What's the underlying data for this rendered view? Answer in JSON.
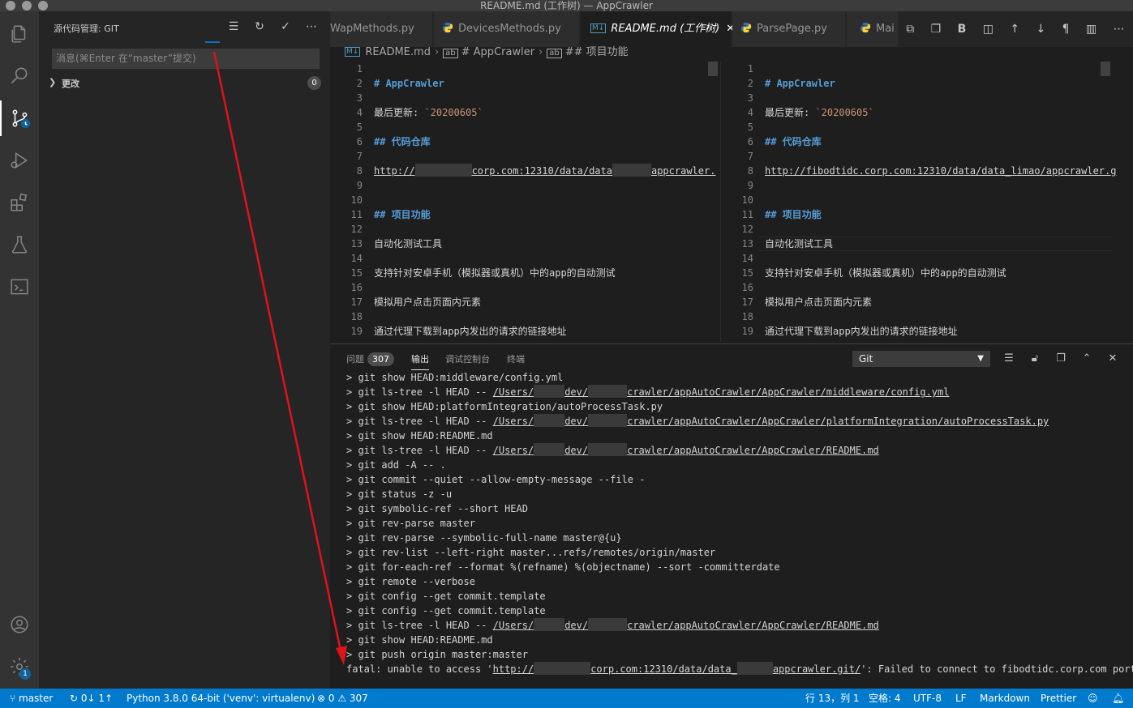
{
  "window": {
    "title": "README.md (工作树) — AppCrawler"
  },
  "activity_bar": {
    "items": [
      {
        "name": "explorer-icon"
      },
      {
        "name": "search-icon"
      },
      {
        "name": "source-control-icon"
      },
      {
        "name": "run-debug-icon"
      },
      {
        "name": "extensions-icon"
      },
      {
        "name": "testing-icon"
      },
      {
        "name": "remote-explorer-icon"
      }
    ],
    "accounts_icon": "account-icon",
    "manage_icon": "gear-icon",
    "manage_badge": "1"
  },
  "scm": {
    "title": "源代码管理: GIT",
    "commit_placeholder": "消息(⌘Enter 在“master”提交)",
    "changes_label": "更改",
    "changes_count": "0"
  },
  "tabs": [
    {
      "label": "WapMethods.py",
      "type": "py"
    },
    {
      "label": "DevicesMethods.py",
      "type": "py"
    },
    {
      "label": "README.md (工作树)",
      "type": "md",
      "active": true
    },
    {
      "label": "ParsePage.py",
      "type": "py"
    },
    {
      "label": "Mai",
      "type": "py"
    }
  ],
  "breadcrumb": {
    "file": "README.md",
    "h1": "# AppCrawler",
    "h2": "## 项目功能"
  },
  "editor_left": {
    "lines": [
      {
        "n": "1",
        "text": ""
      },
      {
        "n": "2",
        "text": "# AppCrawler",
        "kind": "heading"
      },
      {
        "n": "3",
        "text": ""
      },
      {
        "n": "4",
        "prefix": "最后更新: ",
        "code": "`20200605`",
        "kind": "code"
      },
      {
        "n": "5",
        "text": ""
      },
      {
        "n": "6",
        "text": "## 代码仓库",
        "kind": "heading"
      },
      {
        "n": "7",
        "text": ""
      },
      {
        "n": "8",
        "url_a": "http://",
        "url_b": "corp.com:12310/data/data",
        "url_c": "appcrawler.",
        "kind": "redacted-url"
      },
      {
        "n": "9",
        "text": ""
      },
      {
        "n": "10",
        "text": ""
      },
      {
        "n": "11",
        "text": "## 项目功能",
        "kind": "heading"
      },
      {
        "n": "12",
        "text": ""
      },
      {
        "n": "13",
        "text": "自动化测试工具"
      },
      {
        "n": "14",
        "text": ""
      },
      {
        "n": "15",
        "text": "支持针对安卓手机（模拟器或真机）中的app的自动测试"
      },
      {
        "n": "16",
        "text": ""
      },
      {
        "n": "17",
        "text": "模拟用户点击页面内元素"
      },
      {
        "n": "18",
        "text": ""
      },
      {
        "n": "19",
        "text": "通过代理下载到app内发出的请求的链接地址"
      }
    ]
  },
  "editor_right": {
    "lines": [
      {
        "n": "1",
        "text": ""
      },
      {
        "n": "2",
        "text": "# AppCrawler",
        "kind": "heading"
      },
      {
        "n": "3",
        "text": ""
      },
      {
        "n": "4",
        "prefix": "最后更新: ",
        "code": "`20200605`",
        "kind": "code"
      },
      {
        "n": "5",
        "text": ""
      },
      {
        "n": "6",
        "text": "## 代码仓库",
        "kind": "heading"
      },
      {
        "n": "7",
        "text": ""
      },
      {
        "n": "8",
        "text": "http://fibodtidc.corp.com:12310/data/data_limao/appcrawler.g",
        "kind": "link"
      },
      {
        "n": "9",
        "text": ""
      },
      {
        "n": "10",
        "text": ""
      },
      {
        "n": "11",
        "text": "## 项目功能",
        "kind": "heading"
      },
      {
        "n": "12",
        "text": ""
      },
      {
        "n": "13",
        "text": "自动化测试工具"
      },
      {
        "n": "14",
        "text": ""
      },
      {
        "n": "15",
        "text": "支持针对安卓手机（模拟器或真机）中的app的自动测试"
      },
      {
        "n": "16",
        "text": ""
      },
      {
        "n": "17",
        "text": "模拟用户点击页面内元素"
      },
      {
        "n": "18",
        "text": ""
      },
      {
        "n": "19",
        "text": "通过代理下载到app内发出的请求的链接地址"
      }
    ]
  },
  "panel": {
    "tabs": [
      {
        "label": "问题",
        "count": "307"
      },
      {
        "label": "输出",
        "active": true
      },
      {
        "label": "调试控制台"
      },
      {
        "label": "终端"
      }
    ],
    "channel": "Git",
    "output": [
      {
        "text": "> git show HEAD:middleware/config.yml"
      },
      {
        "pre": "> git ls-tree -l HEAD -- ",
        "p1": "/Users/",
        "p2": "dev/",
        "p3": "crawler/appAutoCrawler/AppCrawler/middleware/config.yml",
        "kind": "path"
      },
      {
        "text": "> git show HEAD:platformIntegration/autoProcessTask.py"
      },
      {
        "pre": "> git ls-tree -l HEAD -- ",
        "p1": "/Users/",
        "p2": "dev/",
        "p3": "crawler/appAutoCrawler/AppCrawler/platformIntegration/autoProcessTask.py",
        "kind": "path"
      },
      {
        "text": "> git show HEAD:README.md"
      },
      {
        "pre": "> git ls-tree -l HEAD -- ",
        "p1": "/Users/",
        "p2": "dev/",
        "p3": "crawler/appAutoCrawler/AppCrawler/README.md",
        "kind": "path"
      },
      {
        "text": "> git add -A -- ."
      },
      {
        "text": "> git commit --quiet --allow-empty-message --file -"
      },
      {
        "text": "> git status -z -u"
      },
      {
        "text": "> git symbolic-ref --short HEAD"
      },
      {
        "text": "> git rev-parse master"
      },
      {
        "text": "> git rev-parse --symbolic-full-name master@{u}"
      },
      {
        "text": "> git rev-list --left-right master...refs/remotes/origin/master"
      },
      {
        "text": "> git for-each-ref --format %(refname) %(objectname) --sort -committerdate"
      },
      {
        "text": "> git remote --verbose"
      },
      {
        "text": "> git config --get commit.template"
      },
      {
        "text": "> git config --get commit.template"
      },
      {
        "pre": "> git ls-tree -l HEAD -- ",
        "p1": "/Users/",
        "p2": "dev/",
        "p3": "crawler/appAutoCrawler/AppCrawler/README.md",
        "kind": "path"
      },
      {
        "text": "> git show HEAD:README.md"
      },
      {
        "text": "> git push origin master:master"
      },
      {
        "pre": "fatal: unable to access '",
        "p1": "http://",
        "p2": "corp.com:12310/data/data_",
        "p3": "appcrawler.git/",
        "post": "': Failed to connect to fibodtidc.corp.com port",
        "kind": "fatal"
      }
    ]
  },
  "statusbar": {
    "branch": "master",
    "sync": "0↓ 1↑",
    "python": "Python 3.8.0 64-bit ('venv': virtualenv)",
    "errors": "0",
    "warnings": "307",
    "position": "行 13，列 1",
    "spaces": "空格: 4",
    "encoding": "UTF-8",
    "eol": "LF",
    "language": "Markdown",
    "formatter": "Prettier"
  },
  "colors": {
    "accent": "#007acc",
    "arrow": "#e0121b"
  }
}
